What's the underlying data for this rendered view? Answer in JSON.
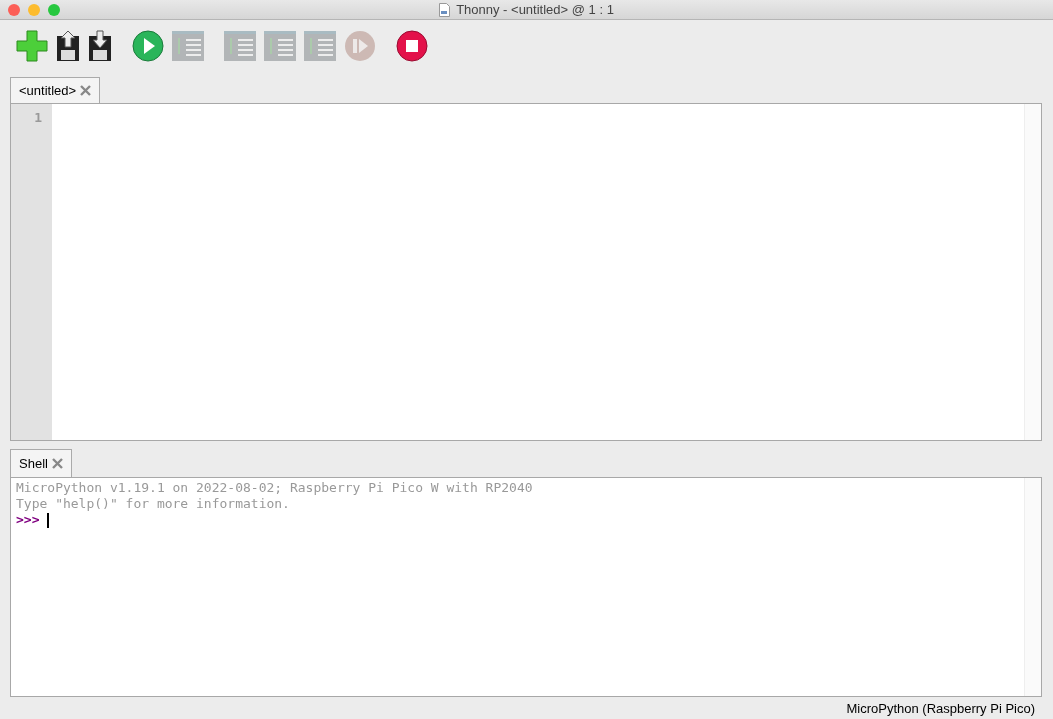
{
  "window": {
    "title": "Thonny  -  <untitled>  @  1 : 1"
  },
  "toolbar": [
    {
      "kind": "new",
      "disabled": false
    },
    {
      "kind": "load",
      "disabled": false
    },
    {
      "kind": "save",
      "disabled": false
    },
    {
      "kind": "run",
      "disabled": false
    },
    {
      "kind": "debug",
      "disabled": true
    },
    {
      "kind": "step-over",
      "disabled": true
    },
    {
      "kind": "step-into",
      "disabled": true
    },
    {
      "kind": "step-out",
      "disabled": true
    },
    {
      "kind": "resume",
      "disabled": true
    },
    {
      "kind": "stop",
      "disabled": false
    }
  ],
  "editor": {
    "tabs": [
      {
        "label": "<untitled>",
        "selected": true
      }
    ],
    "line_numbers": [
      "1"
    ]
  },
  "shell": {
    "tabs": [
      {
        "label": "Shell",
        "selected": true
      }
    ],
    "lines": [
      {
        "kind": "output",
        "text": "MicroPython v1.19.1 on 2022-08-02; Raspberry Pi Pico W with RP2040"
      },
      {
        "kind": "output",
        "text": "Type \"help()\" for more information."
      },
      {
        "kind": "prompt",
        "text": ">>>"
      }
    ]
  },
  "status_bar": {
    "text": "MicroPython (Raspberry Pi Pico)"
  }
}
